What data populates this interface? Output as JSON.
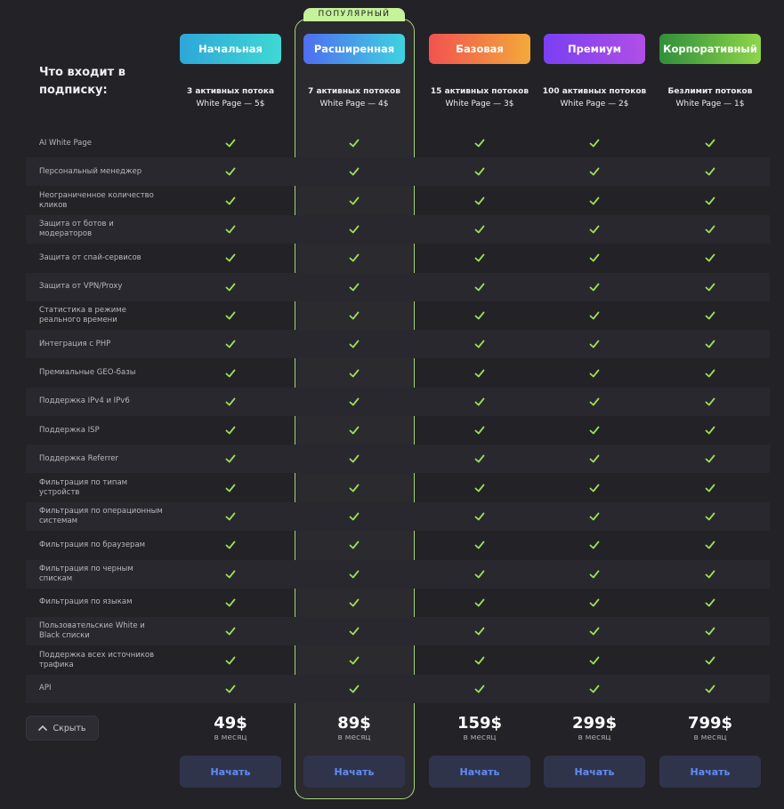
{
  "popular_label": "ПОПУЛЯРНЫЙ",
  "intro_title": "Что входит в подписку:",
  "plans": [
    {
      "name": "Начальная",
      "streams": "3 активных потока",
      "white_page": "White Page — 5$",
      "price": "49$",
      "per": "в месяц",
      "cta": "Начать",
      "gradient": [
        "#2ea6d9",
        "#3fd9d4"
      ]
    },
    {
      "name": "Расширенная",
      "streams": "7 активных потоков",
      "white_page": "White Page — 4$",
      "price": "89$",
      "per": "в месяц",
      "cta": "Начать",
      "gradient": [
        "#4e6ef0",
        "#3fd3e0"
      ]
    },
    {
      "name": "Базовая",
      "streams": "15 активных потоков",
      "white_page": "White Page — 3$",
      "price": "159$",
      "per": "в месяц",
      "cta": "Начать",
      "gradient": [
        "#f2524f",
        "#f3a93b"
      ]
    },
    {
      "name": "Премиум",
      "streams": "100 активных потоков",
      "white_page": "White Page — 2$",
      "price": "299$",
      "per": "в месяц",
      "cta": "Начать",
      "gradient": [
        "#7a3ff2",
        "#b04fe6"
      ]
    },
    {
      "name": "Корпоративный",
      "streams": "Безлимит потоков",
      "white_page": "White Page — 1$",
      "price": "799$",
      "per": "в месяц",
      "cta": "Начать",
      "gradient": [
        "#2f8f3a",
        "#8fd64a"
      ]
    }
  ],
  "features": [
    "AI White Page",
    "Персональный менеджер",
    "Неограниченное количество кликов",
    "Защита от ботов и модераторов",
    "Защита от спай-сервисов",
    "Защита от VPN/Proxy",
    "Статистика в режиме реального времени",
    "Интеграция с PHP",
    "Премиальные GEO-базы",
    "Поддержка IPv4 и IPv6",
    "Поддержка ISP",
    "Поддержка Referrer",
    "Фильтрация по типам устройств",
    "Фильтрация по операционным системам",
    "Фильтрация по браузерам",
    "Фильтрация по черным спискам",
    "Фильтрация по языкам",
    "Пользовательские White и Black списки",
    "Поддержка всех источников трафика",
    "API"
  ],
  "hide_label": "Скрыть",
  "colors": {
    "check": "#9be05a",
    "accent": "#5f8cf5",
    "popular_border": "#a6d57a"
  },
  "icons": {
    "check": "check-icon",
    "collapse": "chevron-up-icon"
  }
}
